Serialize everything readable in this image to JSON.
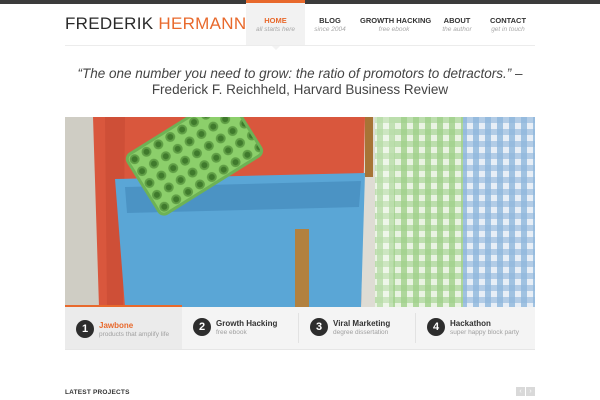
{
  "site": {
    "logo_first": "FREDERIK",
    "logo_last": "HERMANN",
    "accent": "#e8692c"
  },
  "nav": {
    "items": [
      {
        "label": "HOME",
        "sub": "all starts here"
      },
      {
        "label": "BLOG",
        "sub": "since 2004"
      },
      {
        "label": "GROWTH HACKING",
        "sub": "free ebook"
      },
      {
        "label": "ABOUT",
        "sub": "the author"
      },
      {
        "label": "CONTACT",
        "sub": "get in touch"
      }
    ],
    "active_index": 0
  },
  "quote": {
    "text": "“The one number you need to grow: the ratio of promotors to detractors.”",
    "dash": " –",
    "attribution": "Frederick F. Reichheld, Harvard Business Review"
  },
  "hero": {
    "description_icon": "photo-backpack-speaker"
  },
  "slider_tabs": [
    {
      "num": "1",
      "title": "Jawbone",
      "sub": "products that amplify life"
    },
    {
      "num": "2",
      "title": "Growth Hacking",
      "sub": "free ebook"
    },
    {
      "num": "3",
      "title": "Viral Marketing",
      "sub": "degree dissertation"
    },
    {
      "num": "4",
      "title": "Hackathon",
      "sub": "super happy block party"
    }
  ],
  "slider_active_index": 0,
  "projects": {
    "heading": "LATEST PROJECTS",
    "prev_icon": "chevron-left-icon",
    "next_icon": "chevron-right-icon",
    "prev_glyph": "‹",
    "next_glyph": "›"
  }
}
